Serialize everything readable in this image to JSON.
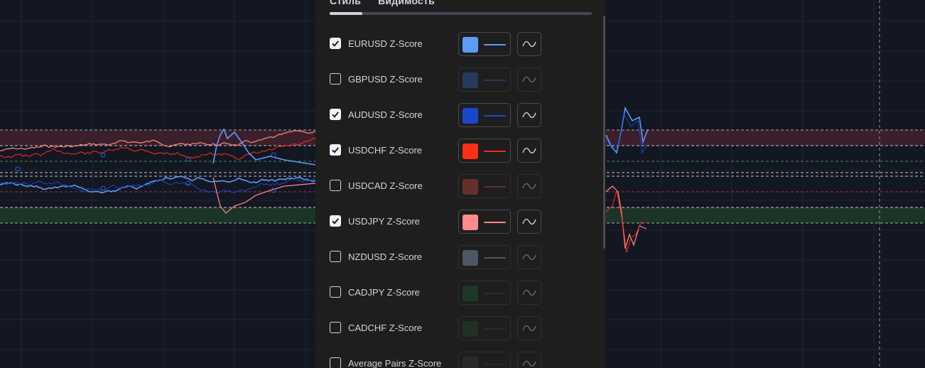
{
  "colors": {
    "background": "#131722",
    "dialog": "#1e1e1e",
    "upper_zone": "#3b1f2b",
    "lower_zone": "#1c3328"
  },
  "tabs": [
    {
      "label": "Стиль",
      "active": true
    },
    {
      "label": "Видимость",
      "active": false
    }
  ],
  "series_rows": [
    {
      "label": "EURUSD Z-Score",
      "checked": true,
      "color": "#5b9cf6",
      "icon": "line-style-icon"
    },
    {
      "label": "GBPUSD Z-Score",
      "checked": false,
      "color": "#2f63b8",
      "icon": "line-style-icon"
    },
    {
      "label": "AUDUSD Z-Score",
      "checked": true,
      "color": "#1848cc",
      "icon": "line-style-icon"
    },
    {
      "label": "USDCHF Z-Score",
      "checked": true,
      "color": "#ff2f16",
      "icon": "line-style-icon"
    },
    {
      "label": "USDCAD Z-Score",
      "checked": false,
      "color": "#c8473e",
      "icon": "line-style-icon"
    },
    {
      "label": "USDJPY Z-Score",
      "checked": true,
      "color": "#ff8a8a",
      "icon": "line-style-icon"
    },
    {
      "label": "NZDUSD Z-Score",
      "checked": false,
      "color": "#8fa6c8",
      "icon": "line-style-icon"
    },
    {
      "label": "CADJPY Z-Score",
      "checked": false,
      "color": "#1b5e32",
      "icon": "line-style-icon"
    },
    {
      "label": "CADCHF Z-Score",
      "checked": false,
      "color": "#1f4d28",
      "icon": "line-style-icon"
    },
    {
      "label": "Average Pairs Z-Score",
      "checked": false,
      "color": "#3a3a3a",
      "icon": "line-style-icon"
    }
  ]
}
